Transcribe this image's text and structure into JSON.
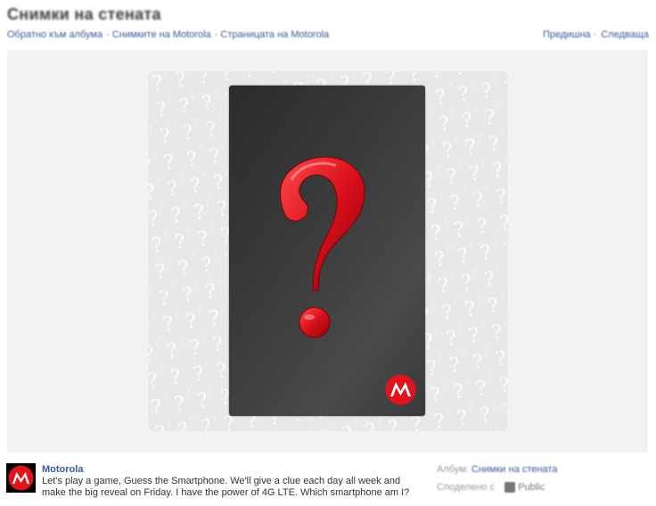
{
  "header": {
    "title": "Снимки на стената",
    "breadcrumb": [
      "Обратно към албума",
      "Снимките на Motorola",
      "Страницата на Motorola"
    ],
    "nav": [
      "Предишна",
      "Следваща"
    ]
  },
  "photo": {
    "symbol": "?",
    "brand_logo": "motorola-logo"
  },
  "post": {
    "author": "Motorola",
    "text_line1": "Let's play a game, Guess the Smartphone. We'll give a clue each day all week and",
    "text_line2": "make the big reveal on Friday. I have the power of 4G LTE. Which smartphone am I?"
  },
  "meta": {
    "album_label": "Албум:",
    "album_link": "Снимки на стената",
    "shared_label": "Споделено с",
    "shared_value": "Public"
  },
  "colors": {
    "link": "#3b5998",
    "question_red": "#d8101c",
    "phone_dark": "#333333"
  }
}
